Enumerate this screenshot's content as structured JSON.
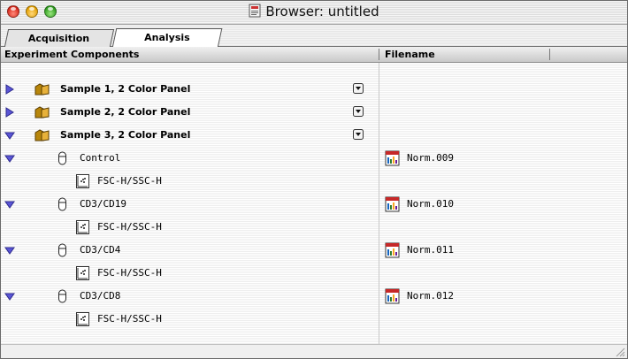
{
  "window": {
    "title": "Browser: untitled"
  },
  "tabs": [
    {
      "label": "Acquisition",
      "selected": false
    },
    {
      "label": "Analysis",
      "selected": true
    }
  ],
  "columns": {
    "components": "Experiment Components",
    "filename": "Filename"
  },
  "samples": [
    {
      "label": "Sample 1, 2 Color Panel",
      "expanded": false
    },
    {
      "label": "Sample 2, 2 Color Panel",
      "expanded": false
    },
    {
      "label": "Sample 3, 2 Color Panel",
      "expanded": true
    }
  ],
  "tubes": [
    {
      "label": "Control",
      "plot": "FSC-H/SSC-H",
      "filename": "Norm.009"
    },
    {
      "label": "CD3/CD19",
      "plot": "FSC-H/SSC-H",
      "filename": "Norm.010"
    },
    {
      "label": "CD3/CD4",
      "plot": "FSC-H/SSC-H",
      "filename": "Norm.011"
    },
    {
      "label": "CD3/CD8",
      "plot": "FSC-H/SSC-H",
      "filename": "Norm.012"
    }
  ],
  "colors": {
    "triangle": "#5a55d6",
    "folder": "#b8860b"
  }
}
